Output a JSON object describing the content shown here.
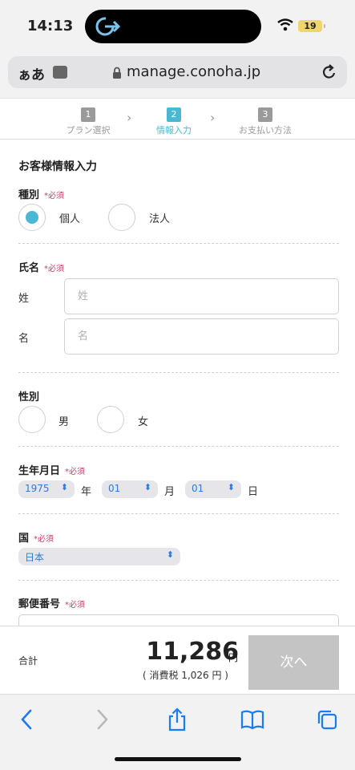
{
  "status_bar": {
    "time": "14:13",
    "battery": "19"
  },
  "browser": {
    "text_size_label": "ぁあ",
    "url": "manage.conoha.jp"
  },
  "steps": [
    {
      "num": "1",
      "label": "プラン選択"
    },
    {
      "num": "2",
      "label": "情報入力"
    },
    {
      "num": "3",
      "label": "お支払い方法"
    }
  ],
  "form": {
    "title": "お客様情報入力",
    "required": "*必須",
    "type": {
      "label": "種別",
      "options": [
        "個人",
        "法人"
      ],
      "selected": "個人"
    },
    "name": {
      "label": "氏名",
      "last_label": "姓",
      "last_placeholder": "姓",
      "first_label": "名",
      "first_placeholder": "名"
    },
    "gender": {
      "label": "性別",
      "options": [
        "男",
        "女"
      ]
    },
    "birthday": {
      "label": "生年月日",
      "year": "1975",
      "year_unit": "年",
      "month": "01",
      "month_unit": "月",
      "day": "01",
      "day_unit": "日"
    },
    "country": {
      "label": "国",
      "value": "日本"
    },
    "postal": {
      "label": "郵便番号"
    }
  },
  "total": {
    "label": "合計",
    "amount": "11,286",
    "unit": "円",
    "tax": "( 消費税 1,026 円 )",
    "next_button": "次へ"
  },
  "colors": {
    "accent": "#4ab8d4",
    "required": "#cc3b6e",
    "link": "#2f7ad6"
  }
}
